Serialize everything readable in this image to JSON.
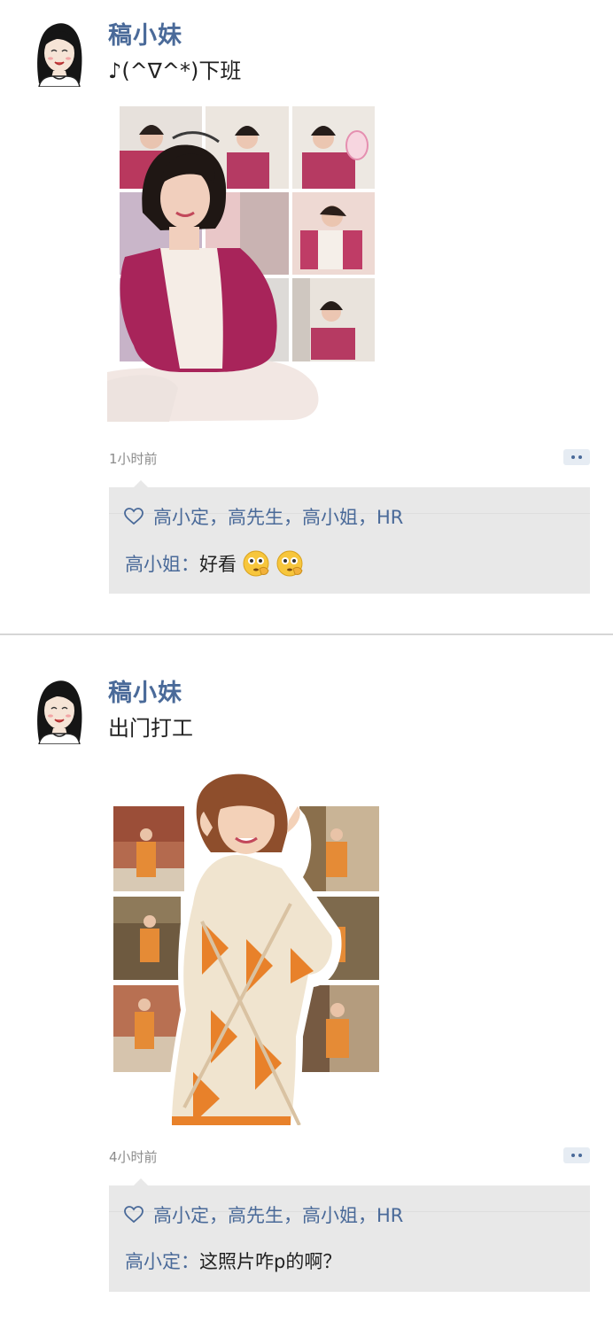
{
  "posts": [
    {
      "name": "稿小妹",
      "text": "♪(^∇^*)下班",
      "time": "1小时前",
      "likes": "高小定，高先生，高小姐，HR",
      "comment_author": "高小姐：",
      "comment_text": "好看"
    },
    {
      "name": "稿小妹",
      "text": "出门打工",
      "time": "4小时前",
      "likes": "高小定，高先生，高小姐，HR",
      "comment_author": "高小定：",
      "comment_text": "这照片咋p的啊？"
    }
  ],
  "colors": {
    "link": "#4a6a99",
    "panel": "#e8e8e8",
    "divider": "#d6d6d6"
  },
  "icons": [
    "avatar-girl-icon",
    "heart-icon",
    "more-dots-icon",
    "flushed-emoji-icon"
  ]
}
